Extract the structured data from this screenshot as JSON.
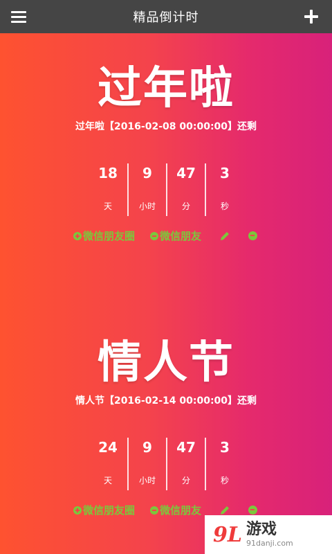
{
  "header": {
    "title": "精品倒计时"
  },
  "events": [
    {
      "title": "过年啦",
      "subtitle": "过年啦【2016-02-08 00:00:00】还剩",
      "countdown": [
        {
          "value": "18",
          "unit": "天"
        },
        {
          "value": "9",
          "unit": "小时"
        },
        {
          "value": "47",
          "unit": "分"
        },
        {
          "value": "3",
          "unit": "秒"
        }
      ],
      "actions": {
        "moments": "微信朋友圈",
        "friends": "微信朋友"
      }
    },
    {
      "title": "情人节",
      "subtitle": "情人节【2016-02-14 00:00:00】还剩",
      "countdown": [
        {
          "value": "24",
          "unit": "天"
        },
        {
          "value": "9",
          "unit": "小时"
        },
        {
          "value": "47",
          "unit": "分"
        },
        {
          "value": "3",
          "unit": "秒"
        }
      ],
      "actions": {
        "moments": "微信朋友圈",
        "friends": "微信朋友"
      }
    }
  ],
  "colors": {
    "header_bg": "#454545",
    "gradient_start": "#fe5230",
    "gradient_end": "#d8217a",
    "action_green": "#7dc63c"
  },
  "icons": {
    "menu": "menu-icon",
    "add": "plus-icon",
    "edit": "pencil-icon",
    "remove": "minus-circle-icon"
  },
  "watermark": {
    "logo": "9L",
    "name": "游戏",
    "site": "91danji.com"
  }
}
